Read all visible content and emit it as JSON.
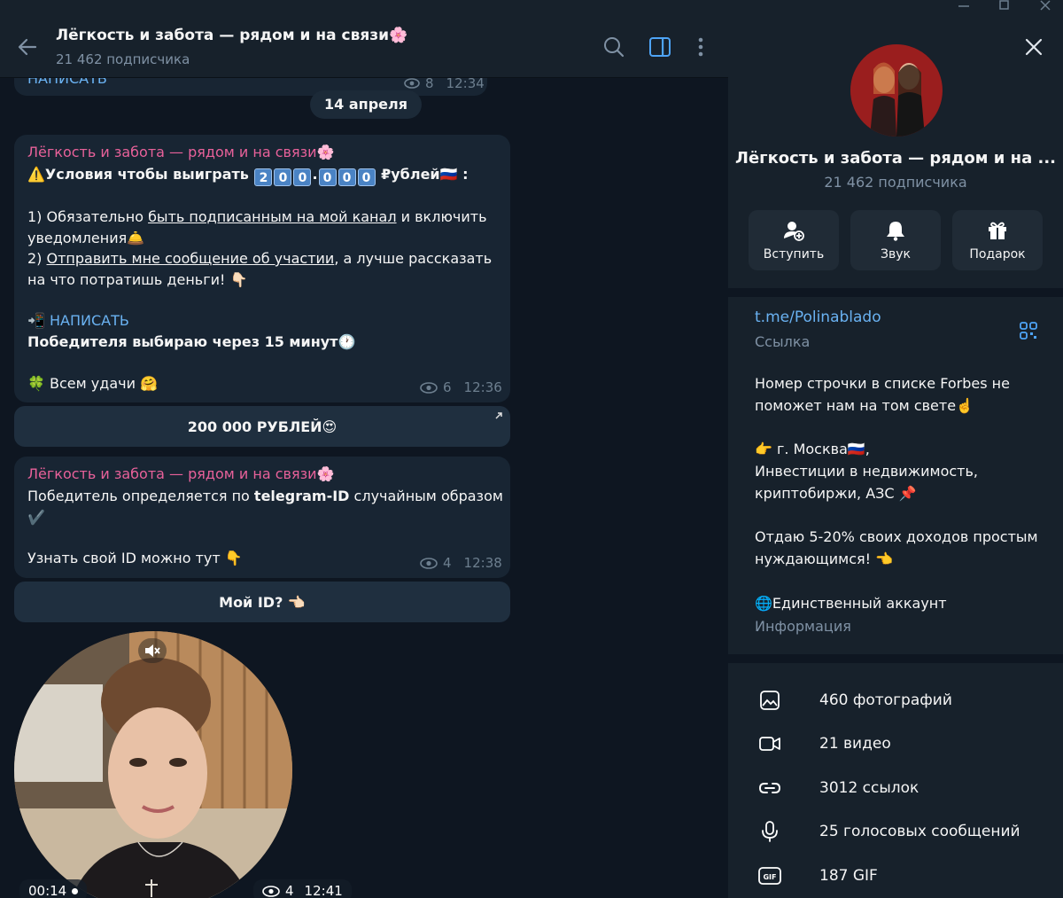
{
  "channel": {
    "title": "Лёгкость и забота — рядом и на связи🌸",
    "subscribers": "21 462 подписчика",
    "short_title": "Лёгкость и забота — рядом и на ...",
    "sender_name": "Лёгкость и забота — рядом и на связи🌸"
  },
  "header": {
    "back_icon": "arrow-left-icon",
    "search_icon": "search-icon",
    "sidebar_icon": "sidebar-toggle-icon",
    "menu_icon": "more-vertical-icon"
  },
  "messages": {
    "m0": {
      "button": "НАПИСАТЬ",
      "views": "8",
      "time": "12:34"
    },
    "date_pill": "14 апреля",
    "m1": {
      "line1_prefix": "⚠️Условия чтобы выиграть ",
      "prize_digits": [
        "2",
        "0",
        "0",
        ".",
        "0",
        "0",
        "0"
      ],
      "line1_suffix": " ₽ублей🇷🇺 :",
      "l2_a": "1) Обязательно ",
      "l2_link": "быть подписанным на мой канал",
      "l2_b": " и включить",
      "l3": "уведомления🛎️",
      "l4_a": "2) ",
      "l4_link": "Отправить мне сообщение об участии",
      "l4_b": ", а лучше рассказать",
      "l5": "на что потратишь деньги! 👇🏻",
      "l6_icon": "📲 ",
      "l6_link": "НАПИСАТЬ",
      "l7": "Победителя выбираю через 15 минут🕐",
      "l8": "🍀 Всем удачи 🤗",
      "views": "6",
      "time": "12:36",
      "inline_button": "200 000 РУБЛЕЙ😍"
    },
    "m2": {
      "l1_a": "Победитель определяется по ",
      "l1_bold": "telegram-ID",
      "l1_b": " случайным образом",
      "l2": "✔️",
      "l3": "Узнать свой ID можно тут 👇",
      "views": "4",
      "time": "12:38",
      "inline_button": "Мой ID? 👈🏻"
    },
    "m3": {
      "duration": "00:14",
      "views": "4",
      "time": "12:41",
      "mute_icon": "speaker-muted-icon"
    }
  },
  "panel": {
    "actions": [
      {
        "label": "Вступить",
        "icon": "add-user-icon"
      },
      {
        "label": "Звук",
        "icon": "bell-icon"
      },
      {
        "label": "Подарок",
        "icon": "gift-icon"
      }
    ],
    "link": "t.me/Polinablado",
    "link_label": "Ссылка",
    "qr_icon": "qr-code-icon",
    "bio": [
      "Номер строчки в списке Forbes не",
      "поможет нам на том свете☝️",
      "",
      "👉 г. Москва🇷🇺,",
      "Инвестиции в недвижимость,",
      "криптобиржи, АЗС 📌",
      "",
      "Отдаю 5-20% своих доходов простым",
      "нуждающимся! 👈",
      "",
      "🌐Единственный аккаунт"
    ],
    "bio_label": "Информация",
    "media": [
      {
        "label": "460 фотографий",
        "icon": "photo-icon"
      },
      {
        "label": "21 видео",
        "icon": "video-icon"
      },
      {
        "label": "3012 ссылок",
        "icon": "link-icon"
      },
      {
        "label": "25 голосовых сообщений",
        "icon": "microphone-icon"
      },
      {
        "label": "187 GIF",
        "icon": "gif-icon"
      }
    ]
  },
  "colors": {
    "background": "#0e1621",
    "panel": "#17212b",
    "bubble": "#182533",
    "accent": "#6ab2f2",
    "sender": "#e8619a"
  }
}
